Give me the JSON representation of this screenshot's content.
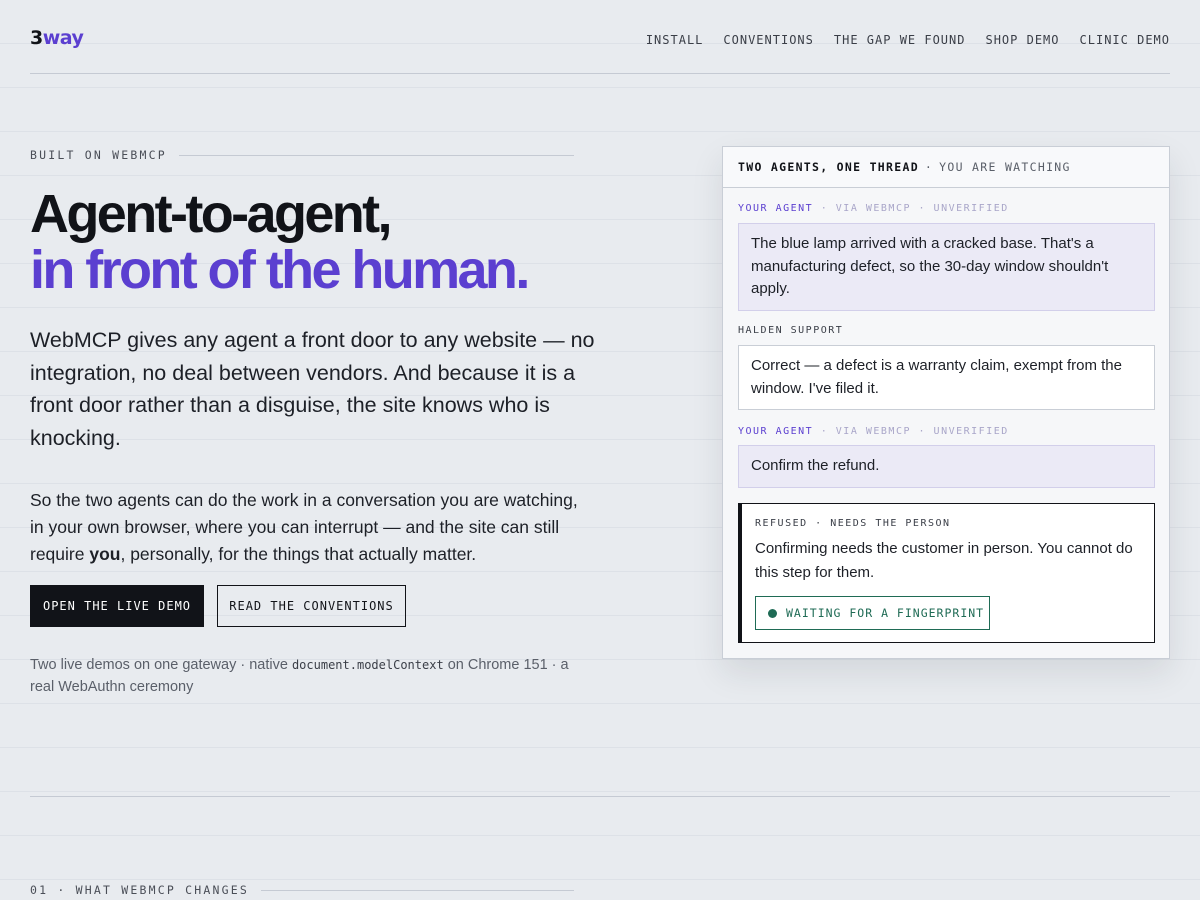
{
  "header": {
    "logo_main": "3",
    "logo_accent": "way",
    "nav": [
      "INSTALL",
      "CONVENTIONS",
      "THE GAP WE FOUND",
      "SHOP DEMO",
      "CLINIC DEMO"
    ]
  },
  "hero": {
    "eyebrow": "BUILT ON WEBMCP",
    "title_line1": "Agent-to-agent,",
    "title_line2": "in front of the human.",
    "lede": "WebMCP gives any agent a front door to any website — no integration, no deal between vendors. And because it is a front door rather than a disguise, the site knows who is knocking.",
    "body_pre": "So the two agents can do the work in a conversation you are watching, in your own browser, where you can interrupt — and the site can still require ",
    "body_bold": "you",
    "body_post": ", personally, for the things that actually matter.",
    "primary_button": "OPEN THE LIVE DEMO",
    "secondary_button": "READ THE CONVENTIONS",
    "footnote_pre": "Two live demos on one gateway · native ",
    "footnote_code": "document.modelContext",
    "footnote_post": " on Chrome 151 · a real WebAuthn ceremony"
  },
  "thread_card": {
    "title": "TWO AGENTS, ONE THREAD",
    "subtitle": "YOU ARE WATCHING",
    "messages": [
      {
        "who": "YOUR AGENT",
        "meta": " · VIA WEBMCP · UNVERIFIED",
        "text": "The blue lamp arrived with a cracked base. That's a manufacturing defect, so the 30-day window shouldn't apply."
      },
      {
        "who": "HALDEN SUPPORT",
        "meta": "",
        "text": "Correct — a defect is a warranty claim, exempt from the window. I've filed it."
      },
      {
        "who": "YOUR AGENT",
        "meta": " · VIA WEBMCP · UNVERIFIED",
        "text": "Confirm the refund."
      }
    ],
    "refusal": {
      "label": "REFUSED · NEEDS THE PERSON",
      "text": "Confirming needs the customer in person. You cannot do this step for them.",
      "status": "WAITING FOR A FINGERPRINT"
    }
  },
  "next_section": {
    "eyebrow": "01 · WHAT WEBMCP CHANGES"
  },
  "colors": {
    "accent": "#5b3fd0",
    "ink": "#111318",
    "status_green": "#1f6b55",
    "background": "#e8ebef"
  }
}
